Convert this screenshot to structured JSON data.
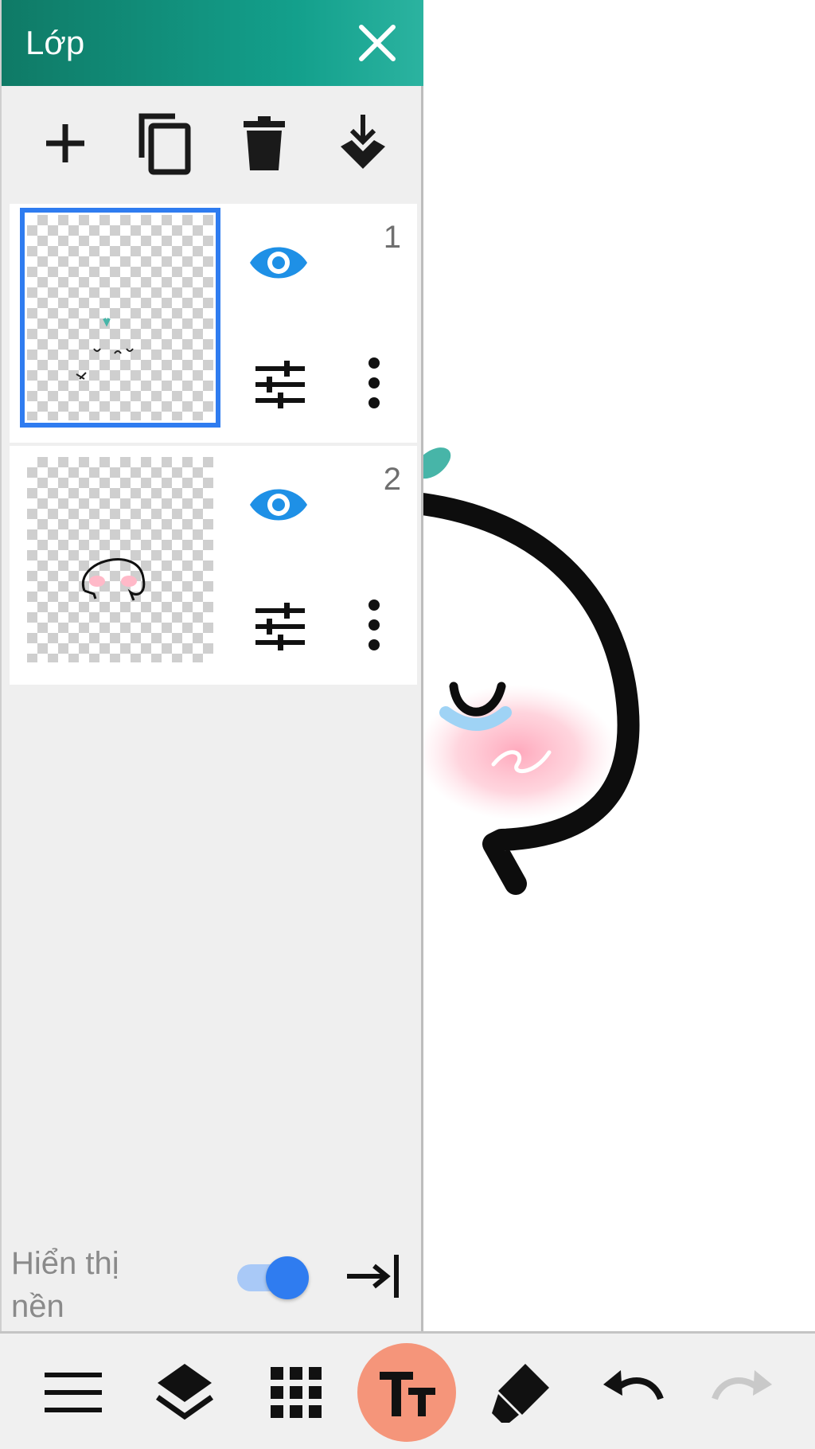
{
  "panel": {
    "title": "Lớp",
    "toolbar": [
      "add-layer",
      "duplicate-layer",
      "delete-layer",
      "merge-down"
    ]
  },
  "layers": [
    {
      "number": "1",
      "selected": true
    },
    {
      "number": "2",
      "selected": false
    }
  ],
  "background": {
    "label": "Hiển thị nền",
    "enabled": true
  },
  "bottom_bar": {
    "tools": [
      "menu",
      "layers",
      "grid",
      "text",
      "eraser",
      "undo",
      "redo"
    ],
    "active_tool": "text",
    "accent_color": "#f5957a"
  },
  "colors": {
    "header": "#13a08c",
    "accent_blue": "#2f7cf0",
    "eye_blue": "#1e90e6"
  }
}
